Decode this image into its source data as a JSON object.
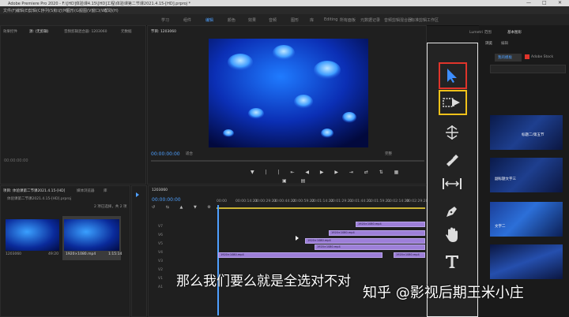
{
  "window": {
    "title": "Adobe Premiere Pro 2020 - F:\\[HD]体验课4.15\\[HD]工程\\体验课第二节课2021.4.15-[HD].prproj *"
  },
  "menu": [
    "文件(F)",
    "编辑(E)",
    "剪辑(C)",
    "序列(S)",
    "标记(M)",
    "图形(G)",
    "视图(V)",
    "窗口(W)",
    "帮助(H)"
  ],
  "workspaces": [
    {
      "label": "学习",
      "active": false
    },
    {
      "label": "组件",
      "active": false
    },
    {
      "label": "编辑",
      "active": true
    },
    {
      "label": "颜色",
      "active": false
    },
    {
      "label": "效果",
      "active": false
    },
    {
      "label": "音频",
      "active": false
    },
    {
      "label": "图形",
      "active": false
    },
    {
      "label": "库",
      "active": false
    },
    {
      "label": "Editing",
      "active": false
    },
    {
      "label": "所有面板",
      "active": false
    },
    {
      "label": "元数据记录",
      "active": false
    },
    {
      "label": "音频剪辑混合器",
      "active": false
    },
    {
      "label": "标准剪辑工作区",
      "active": false
    }
  ],
  "source_panel": {
    "tabs": [
      "效果控件",
      "源: (无剪辑)",
      "音频剪辑混合器: 1203060",
      "元数据"
    ],
    "timecode": "00:00:00:00"
  },
  "program_panel": {
    "tab": "节目: 1203060",
    "timecode_left": "00:00:00:00",
    "fit_label": "适合",
    "full_label": "完整",
    "timecode_right": "00:00:48:08"
  },
  "project_panel": {
    "tabs": [
      "项目: 体验课第二节课2021.4.15-[HD]",
      "媒体浏览器",
      "库"
    ],
    "path": "体验课第二节课2021.4.15-[HD].prproj",
    "count": "2 项已选择，共 2 项",
    "clips": [
      {
        "name": "1203060",
        "duration": "49:20"
      },
      {
        "name": "1920×1080.mp4",
        "duration": "1:15:14"
      }
    ]
  },
  "timeline": {
    "tab": "1203060",
    "timecode": "00:00:00:00",
    "ruler": [
      "00:00",
      "00:00:14:23",
      "00:00:29:23",
      "00:00:44:22",
      "00:00:59:22",
      "00:01:14:22",
      "00:01:29:21",
      "00:01:44:21",
      "00:01:59:21",
      "00:02:14:20",
      "00:02:29:20"
    ],
    "tracks": [
      "V7",
      "V6",
      "V5",
      "V4",
      "V3",
      "V2",
      "V1",
      "A1"
    ],
    "clips": [
      {
        "label": "1920×1080.mp4"
      },
      {
        "label": "1920×1080.mp4"
      },
      {
        "label": "1920×1080.mp4"
      },
      {
        "label": "1920×1080.mp4"
      },
      {
        "label": "1920×1080.mp4"
      },
      {
        "label": "1920×1080.mp4"
      }
    ]
  },
  "tools": [
    {
      "name": "selection-tool",
      "highlight": "#e0342b",
      "letter": "V",
      "letter_color": "#e0342b"
    },
    {
      "name": "track-select-forward-tool",
      "highlight": "#f0c21a",
      "letter": "A",
      "letter_color": "#f0c21a"
    },
    {
      "name": "ripple-edit-tool"
    },
    {
      "name": "razor-tool"
    },
    {
      "name": "slip-tool"
    },
    {
      "name": "pen-tool"
    },
    {
      "name": "hand-tool"
    },
    {
      "name": "type-tool"
    }
  ],
  "right_panel": {
    "tabs": [
      "Lumetri 范围",
      "基本图形"
    ],
    "subtabs": [
      "浏览",
      "编辑"
    ],
    "my_templates": "我的模板",
    "adobe_stock": "Adobe Stock",
    "previews": [
      "标题二/第五节",
      "副标题文字三",
      "文字二",
      "",
      ""
    ]
  },
  "subtitle": "那么我们要么就是全选对不对",
  "watermark": "知乎 @影视后期王米小庄",
  "colors": {
    "accent": "#4ea0ff",
    "clip": "#9d7fd8",
    "selection": "#e0342b",
    "track_select": "#f0c21a"
  }
}
